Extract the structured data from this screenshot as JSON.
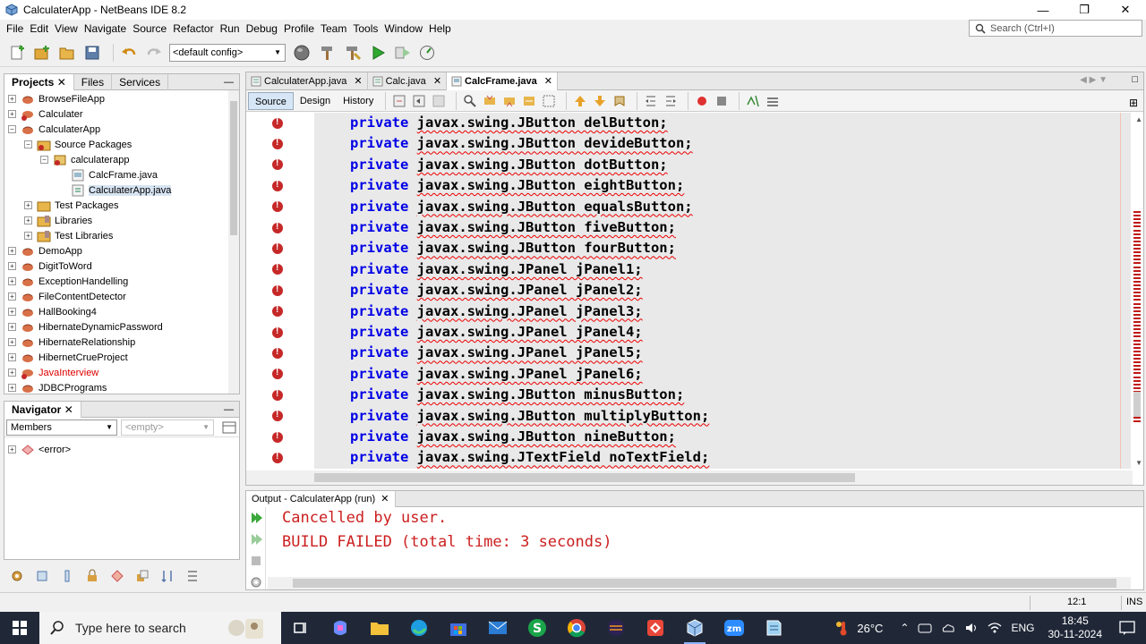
{
  "window": {
    "title": "CalculaterApp - NetBeans IDE 8.2"
  },
  "menu": [
    "File",
    "Edit",
    "View",
    "Navigate",
    "Source",
    "Refactor",
    "Run",
    "Debug",
    "Profile",
    "Team",
    "Tools",
    "Window",
    "Help"
  ],
  "search": {
    "placeholder": "Search (Ctrl+I)"
  },
  "toolbar": {
    "config": "<default config>"
  },
  "projects_panel": {
    "tabs": [
      "Projects",
      "Files",
      "Services"
    ],
    "items": [
      {
        "label": "BrowseFileApp"
      },
      {
        "label": "Calculater"
      },
      {
        "label": "CalculaterApp"
      },
      {
        "label": "Source Packages"
      },
      {
        "label": "calculaterapp"
      },
      {
        "label": "CalcFrame.java"
      },
      {
        "label": "CalculaterApp.java"
      },
      {
        "label": "Test Packages"
      },
      {
        "label": "Libraries"
      },
      {
        "label": "Test Libraries"
      },
      {
        "label": "DemoApp"
      },
      {
        "label": "DigitToWord"
      },
      {
        "label": "ExceptionHandelling"
      },
      {
        "label": "FileContentDetector"
      },
      {
        "label": "HallBooking4"
      },
      {
        "label": "HibernateDynamicPassword"
      },
      {
        "label": "HibernateRelationship"
      },
      {
        "label": "HibernetCrueProject"
      },
      {
        "label": "JavaInterview"
      },
      {
        "label": "JDBCPrograms"
      }
    ]
  },
  "navigator": {
    "title": "Navigator",
    "members": "Members",
    "empty": "<empty>",
    "error_item": "<error>"
  },
  "editor": {
    "tabs": [
      "CalculaterApp.java",
      "Calc.java",
      "CalcFrame.java"
    ],
    "views": [
      "Source",
      "Design",
      "History"
    ],
    "lines": [
      {
        "kw": "private",
        "rest": "javax.swing.JButton delButton;"
      },
      {
        "kw": "private",
        "rest": "javax.swing.JButton devideButton;"
      },
      {
        "kw": "private",
        "rest": "javax.swing.JButton dotButton;"
      },
      {
        "kw": "private",
        "rest": "javax.swing.JButton eightButton;"
      },
      {
        "kw": "private",
        "rest": "javax.swing.JButton equalsButton;"
      },
      {
        "kw": "private",
        "rest": "javax.swing.JButton fiveButton;"
      },
      {
        "kw": "private",
        "rest": "javax.swing.JButton fourButton;"
      },
      {
        "kw": "private",
        "rest": "javax.swing.JPanel jPanel1;"
      },
      {
        "kw": "private",
        "rest": "javax.swing.JPanel jPanel2;"
      },
      {
        "kw": "private",
        "rest": "javax.swing.JPanel jPanel3;"
      },
      {
        "kw": "private",
        "rest": "javax.swing.JPanel jPanel4;"
      },
      {
        "kw": "private",
        "rest": "javax.swing.JPanel jPanel5;"
      },
      {
        "kw": "private",
        "rest": "javax.swing.JPanel jPanel6;"
      },
      {
        "kw": "private",
        "rest": "javax.swing.JButton minusButton;"
      },
      {
        "kw": "private",
        "rest": "javax.swing.JButton multiplyButton;"
      },
      {
        "kw": "private",
        "rest": "javax.swing.JButton nineButton;"
      },
      {
        "kw": "private",
        "rest": "javax.swing.JTextField noTextField;"
      }
    ]
  },
  "output": {
    "tab": "Output - CalculaterApp (run)",
    "lines": [
      "Cancelled by user.",
      "BUILD FAILED (total time: 3 seconds)"
    ]
  },
  "status": {
    "position": "12:1",
    "mode": "INS"
  },
  "taskbar": {
    "search_placeholder": "Type here to search",
    "weather": "26°C",
    "language": "ENG",
    "time": "18:45",
    "date": "30-11-2024"
  },
  "colors": {
    "keyword": "#0000e6",
    "error": "#cc1f1f",
    "taskbar": "#202838"
  }
}
